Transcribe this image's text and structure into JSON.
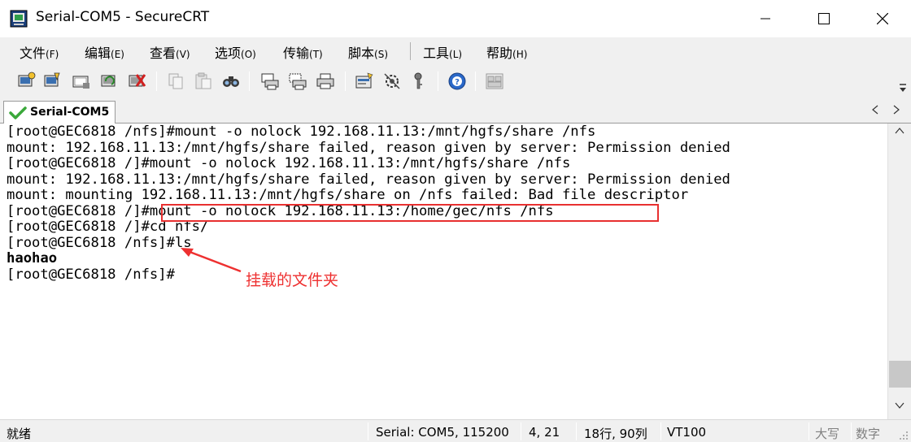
{
  "window": {
    "title": "Serial-COM5 - SecureCRT",
    "icon": "securecrt-app-icon",
    "controls": [
      "minimize-icon",
      "maximize-icon",
      "close-icon"
    ]
  },
  "menu": {
    "items": [
      {
        "label": "文件",
        "accel": "(F)"
      },
      {
        "label": "编辑",
        "accel": "(E)"
      },
      {
        "label": "查看",
        "accel": "(V)"
      },
      {
        "label": "选项",
        "accel": "(O)"
      },
      {
        "label": "传输",
        "accel": "(T)"
      },
      {
        "label": "脚本",
        "accel": "(S)"
      },
      {
        "label": "工具",
        "accel": "(L)"
      },
      {
        "label": "帮助",
        "accel": "(H)"
      }
    ]
  },
  "toolbar": {
    "icons": [
      "connect-icon",
      "quick-connect-icon",
      "connect-in-tab-icon",
      "reconnect-icon",
      "disconnect-icon",
      "copy-icon",
      "paste-icon",
      "find-icon",
      "print-screen-icon",
      "print-selection-icon",
      "print-icon",
      "session-options-icon",
      "global-options-icon",
      "keymap-icon",
      "help-icon",
      "tile-windows-icon"
    ]
  },
  "tabs": {
    "active_label": "Serial-COM5",
    "status_icon": "checkmark-icon"
  },
  "terminal": {
    "lines": [
      "[root@GEC6818 /nfs]#mount -o nolock 192.168.11.13:/mnt/hgfs/share /nfs",
      "mount: 192.168.11.13:/mnt/hgfs/share failed, reason given by server: Permission denied",
      "[root@GEC6818 /]#mount -o nolock 192.168.11.13:/mnt/hgfs/share /nfs",
      "mount: 192.168.11.13:/mnt/hgfs/share failed, reason given by server: Permission denied",
      "mount: mounting 192.168.11.13:/mnt/hgfs/share on /nfs failed: Bad file descriptor",
      "[root@GEC6818 /]#mount -o nolock 192.168.11.13:/home/gec/nfs /nfs",
      "[root@GEC6818 /]#cd nfs/",
      "[root@GEC6818 /nfs]#ls",
      "haohao",
      "[root@GEC6818 /nfs]#"
    ],
    "annotation": "挂载的文件夹",
    "highlight_color": "#e83030"
  },
  "status": {
    "ready": "就绪",
    "connection": "Serial: COM5, 115200",
    "cursor_pos": "4,  21",
    "size": "18行, 90列",
    "emulation": "VT100",
    "caps": "大写",
    "num": "数字"
  }
}
